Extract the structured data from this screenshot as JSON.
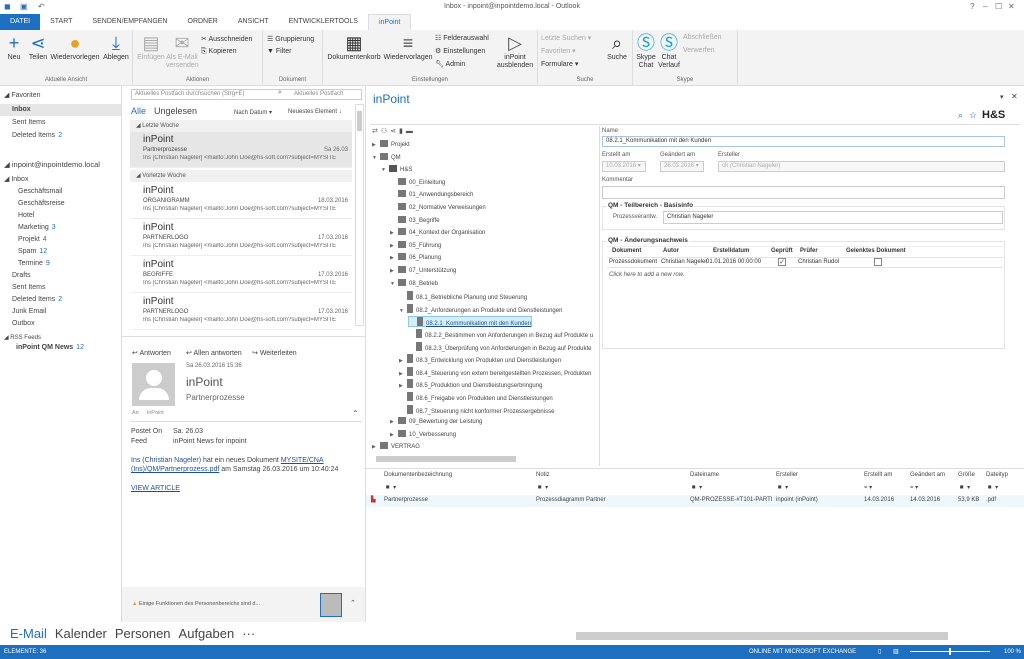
{
  "window": {
    "title": "Inbox - inpoint@inpointdemo.local - Outlook",
    "help": "?",
    "minimize": "–",
    "maximize": "☐",
    "close": "✕"
  },
  "tabs": [
    {
      "label": "DATEI"
    },
    {
      "label": "START"
    },
    {
      "label": "SENDEN/EMPFANGEN"
    },
    {
      "label": "ORDNER"
    },
    {
      "label": "ANSICHT"
    },
    {
      "label": "ENTWICKLERTOOLS"
    },
    {
      "label": "inPoint",
      "active": true
    }
  ],
  "ribbon": {
    "aktuelle": {
      "label": "Aktuelle Ansicht",
      "neu": "Neu",
      "teilen": "Teilen",
      "wiedervorlegen": "Wiedervorlegen",
      "ablegen": "Ablegen"
    },
    "aktionen": {
      "label": "Aktionen",
      "einfuegen": "Einfügen",
      "als_email": "Als E-Mail versenden",
      "ausschneiden": "Ausschneiden",
      "kopieren": "Kopieren"
    },
    "dokument": {
      "label": "Dokument",
      "gruppierung": "Gruppierung",
      "filter": "Filter"
    },
    "einstellungen": {
      "label": "Einstellungen",
      "dokumentenkorb": "Dokumentenkorb",
      "wiedervorlagen": "Wiedervorlagen",
      "felderauswahl": "Felderauswahl",
      "einstellungen": "Einstellungen",
      "admin": "Admin",
      "ausblenden": "inPoint ausblenden"
    },
    "suche": {
      "label": "Suche",
      "letzte": "Letzte Suchen",
      "favoriten": "Favoriten",
      "formulare": "Formulare",
      "suche": "Suche"
    },
    "skype": {
      "label": "Skype",
      "chat": "Skype Chat",
      "verlauf": "Chat Verlauf",
      "abschliessen": "Abschließen",
      "verwerfen": "Verwerfen"
    }
  },
  "nav": {
    "favorites_header": "Favoriten",
    "favorites": [
      {
        "label": "Inbox",
        "selected": true
      },
      {
        "label": "Sent Items"
      },
      {
        "label": "Deleted Items",
        "count": "2"
      }
    ],
    "account": "inpoint@inpointdemo.local",
    "inbox": "Inbox",
    "subfolders": [
      {
        "label": "Geschäftsmail"
      },
      {
        "label": "Geschäftsreise"
      },
      {
        "label": "Hotel"
      },
      {
        "label": "Marketing",
        "count": "3"
      },
      {
        "label": "Projekt",
        "count": "4"
      },
      {
        "label": "Spam",
        "count": "12"
      },
      {
        "label": "Termine",
        "count": "9"
      }
    ],
    "folders": [
      {
        "label": "Drafts"
      },
      {
        "label": "Sent Items"
      },
      {
        "label": "Deleted Items",
        "count": "2"
      },
      {
        "label": "Junk Email"
      },
      {
        "label": "Outbox"
      }
    ],
    "rss": "RSS Feeds",
    "rss_feed": {
      "label": "inPoint QM News",
      "count": "12"
    }
  },
  "list": {
    "search_placeholder": "Aktuelles Postfach durchsuchen (Strg+E)",
    "scope": "Aktuelles Postfach",
    "filter_all": "Alle",
    "filter_unread": "Ungelesen",
    "sort": "Nach Datum",
    "order": "Neuestes Element ↓",
    "group1": "Letzte Woche",
    "group2": "Vorletzte Woche",
    "messages": [
      {
        "from": "inPoint",
        "subject": "Partnerprozesse",
        "date": "Sa 26.03",
        "preview": "Ins [Christian Nageler] <mailto:John Doe@hs-soft.com?subject=MYSITE"
      },
      {
        "from": "inPoint",
        "subject": "ORGANIGRAMM",
        "date": "18.03.2016",
        "preview": "Ins [Christian Nageler] <mailto:John Doe@hs-soft.com?subject=MYSITE"
      },
      {
        "from": "inPoint",
        "subject": "PARTNERLOGO",
        "date": "17.03.2016",
        "preview": "Ins [Christian Nageler] <mailto:John Doe@hs-soft.com?subject=MYSITE"
      },
      {
        "from": "inPoint",
        "subject": "BEGRIFFE",
        "date": "17.03.2016",
        "preview": "Ins [Christian Nageler] <mailto:John Doe@hs-soft.com?subject=MYSITE"
      },
      {
        "from": "inPoint",
        "subject": "PARTNERLOGO",
        "date": "17.03.2016",
        "preview": "Ins [Christian Nageler] <mailto:John Doe@hs-soft.com?subject=MYSITE"
      }
    ]
  },
  "reading": {
    "reply": "Antworten",
    "reply_all": "Allen antworten",
    "forward": "Weiterleiten",
    "datetime": "Sa 26.03.2016 15:36",
    "from": "inPoint",
    "subject": "Partnerprozesse",
    "to_label": "An",
    "to": "inPoint",
    "posted_label": "Postet On",
    "posted": "Sa. 26.03",
    "feed_label": "Feed",
    "feed": "inPoint News for inpoint",
    "body_author": "Ins (Christian Nageler)",
    "body_text1": " hat ein neues Dokument ",
    "body_link": "MYSITE/CNA (Ins)/QM/Partnerprozess.pdf",
    "body_text2": " am Samstag 26.03.2016 um 10:40:24",
    "view": "VIEW ARTICLE",
    "people_notice": "Einige Funktionen des Personenbereichs sind d..."
  },
  "bottomnav": [
    "E-Mail",
    "Kalender",
    "Personen",
    "Aufgaben",
    "···"
  ],
  "inpoint": {
    "title": "inPoint",
    "brand": "H&S",
    "tree": [
      {
        "label": "Projekt",
        "lvl": 0,
        "exp": "▶",
        "icon": "library"
      },
      {
        "label": "QM",
        "lvl": 0,
        "exp": "▼",
        "icon": "library"
      },
      {
        "label": "H&S",
        "lvl": 1,
        "exp": "▼",
        "icon": "home"
      },
      {
        "label": "00_Einleitung",
        "lvl": 2,
        "exp": ""
      },
      {
        "label": "01_Anwendungsbereich",
        "lvl": 2,
        "exp": ""
      },
      {
        "label": "02_Normative Verweisungen",
        "lvl": 2,
        "exp": ""
      },
      {
        "label": "03_Begriffe",
        "lvl": 2,
        "exp": ""
      },
      {
        "label": "04_Kontext der Organisation",
        "lvl": 2,
        "exp": "▶"
      },
      {
        "label": "05_Führung",
        "lvl": 2,
        "exp": "▶"
      },
      {
        "label": "06_Planung",
        "lvl": 2,
        "exp": "▶"
      },
      {
        "label": "07_Unterstützung",
        "lvl": 2,
        "exp": "▶"
      },
      {
        "label": "08_Betrieb",
        "lvl": 2,
        "exp": "▼"
      },
      {
        "label": "08.1_Betriebliche Planung und Steuerung",
        "lvl": 3,
        "exp": ""
      },
      {
        "label": "08.2_Anforderungen an Produkte und Dienstleistungen",
        "lvl": 3,
        "exp": "▼"
      },
      {
        "label": "08.2.1_Kommunikation mit den Kunden",
        "lvl": 4,
        "exp": "",
        "sel": true
      },
      {
        "label": "08.2.2_Bestimmen von Anforderungen in Bezug auf Produkte u",
        "lvl": 4,
        "exp": ""
      },
      {
        "label": "08.2.3_Überprüfung von Anforderungen in Bezug auf Produkte",
        "lvl": 4,
        "exp": ""
      },
      {
        "label": "08.3_Entwicklung von Produkten und Dienstleistungen",
        "lvl": 3,
        "exp": "▶"
      },
      {
        "label": "08.4_Steuerung von extern bereitgestellten Prozessen, Produkten",
        "lvl": 3,
        "exp": "▶"
      },
      {
        "label": "08.5_Produktion und Dienstleistungserbringung",
        "lvl": 3,
        "exp": "▶"
      },
      {
        "label": "08.6_Freigabe von Produkten und Dienstleistungen",
        "lvl": 3,
        "exp": ""
      },
      {
        "label": "08.7_Steuerung nicht konformer Prozessergebnisse",
        "lvl": 3,
        "exp": ""
      },
      {
        "label": "09_Bewertung der Leistung",
        "lvl": 2,
        "exp": "▶"
      },
      {
        "label": "10_Verbesserung",
        "lvl": 2,
        "exp": "▶"
      },
      {
        "label": "VERTRAG",
        "lvl": 0,
        "exp": "▶",
        "icon": "library"
      }
    ],
    "form": {
      "name_label": "Name",
      "name": "08.2.1_Kommunikation mit den Kunden",
      "created_label": "Erstellt am",
      "created": "10.03.2016",
      "changed_label": "Geändert am",
      "changed": "26.03.2016",
      "creator_label": "Ersteller",
      "creator": "ch (Christian Nageler)",
      "comment_label": "Kommentar",
      "comment": "",
      "sec1": "QM - Teilbereich - Basisinfo",
      "owner_label": "Prozessverantw.",
      "owner": "Christian Nageler",
      "sec2": "QM - Änderungsnachweis",
      "cols": [
        "Dokument",
        "Autor",
        "Erstelldatum",
        "Geprüft",
        "Prüfer",
        "Gelenktes Dokument"
      ],
      "row": {
        "dokument": "Prozessdokument",
        "autor": "Christian Nageler",
        "datum": "01.01.2016 00:00:00",
        "geprueft": true,
        "pruefer": "Christian Rudol",
        "gelenkt": false
      },
      "add_row": "Click here to add a new row."
    },
    "docs": {
      "cols": [
        "Dokumentenbezeichnung",
        "Notiz",
        "Dateiname",
        "Ersteller",
        "Erstellt am",
        "Geändert am",
        "Größe",
        "Dateityp"
      ],
      "rows": [
        {
          "name": "Partnerprozesse",
          "notiz": "Prozessdiagramm Partner",
          "datei": "QM-PROZESSE-#T101-PARTI",
          "ersteller": "inpoint (inPoint)",
          "erstellt": "14.03.2016",
          "geaendert": "14.03.2016",
          "groesse": "53,9 KB",
          "typ": ".pdf"
        }
      ]
    }
  },
  "status": {
    "items": "ELEMENTE: 36",
    "connection": "ONLINE MIT MICROSOFT EXCHANGE",
    "zoom": "100 %",
    "zoom_percent": 100
  },
  "colors": {
    "accent": "#1e6fc0",
    "count": "#1e6fc0",
    "selection": "#d6eef8"
  }
}
